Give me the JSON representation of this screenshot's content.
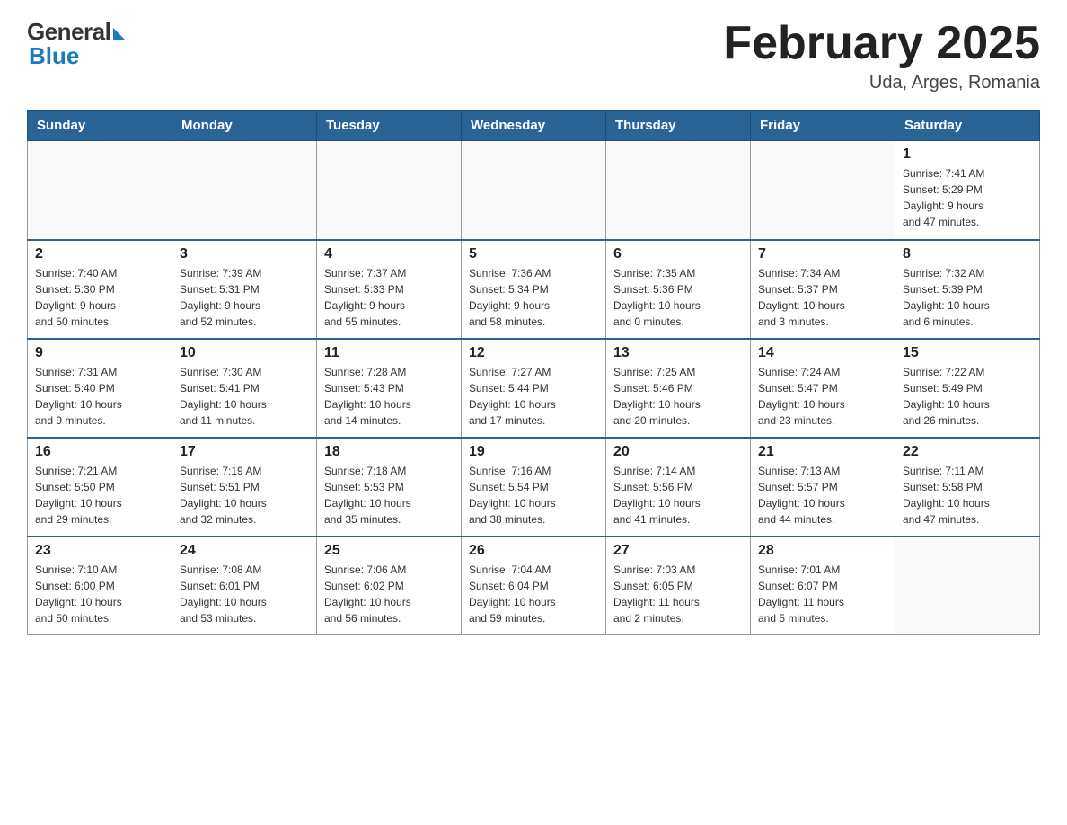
{
  "header": {
    "logo_general": "General",
    "logo_blue": "Blue",
    "month_title": "February 2025",
    "location": "Uda, Arges, Romania"
  },
  "weekdays": [
    "Sunday",
    "Monday",
    "Tuesday",
    "Wednesday",
    "Thursday",
    "Friday",
    "Saturday"
  ],
  "weeks": [
    [
      {
        "day": "",
        "info": ""
      },
      {
        "day": "",
        "info": ""
      },
      {
        "day": "",
        "info": ""
      },
      {
        "day": "",
        "info": ""
      },
      {
        "day": "",
        "info": ""
      },
      {
        "day": "",
        "info": ""
      },
      {
        "day": "1",
        "info": "Sunrise: 7:41 AM\nSunset: 5:29 PM\nDaylight: 9 hours\nand 47 minutes."
      }
    ],
    [
      {
        "day": "2",
        "info": "Sunrise: 7:40 AM\nSunset: 5:30 PM\nDaylight: 9 hours\nand 50 minutes."
      },
      {
        "day": "3",
        "info": "Sunrise: 7:39 AM\nSunset: 5:31 PM\nDaylight: 9 hours\nand 52 minutes."
      },
      {
        "day": "4",
        "info": "Sunrise: 7:37 AM\nSunset: 5:33 PM\nDaylight: 9 hours\nand 55 minutes."
      },
      {
        "day": "5",
        "info": "Sunrise: 7:36 AM\nSunset: 5:34 PM\nDaylight: 9 hours\nand 58 minutes."
      },
      {
        "day": "6",
        "info": "Sunrise: 7:35 AM\nSunset: 5:36 PM\nDaylight: 10 hours\nand 0 minutes."
      },
      {
        "day": "7",
        "info": "Sunrise: 7:34 AM\nSunset: 5:37 PM\nDaylight: 10 hours\nand 3 minutes."
      },
      {
        "day": "8",
        "info": "Sunrise: 7:32 AM\nSunset: 5:39 PM\nDaylight: 10 hours\nand 6 minutes."
      }
    ],
    [
      {
        "day": "9",
        "info": "Sunrise: 7:31 AM\nSunset: 5:40 PM\nDaylight: 10 hours\nand 9 minutes."
      },
      {
        "day": "10",
        "info": "Sunrise: 7:30 AM\nSunset: 5:41 PM\nDaylight: 10 hours\nand 11 minutes."
      },
      {
        "day": "11",
        "info": "Sunrise: 7:28 AM\nSunset: 5:43 PM\nDaylight: 10 hours\nand 14 minutes."
      },
      {
        "day": "12",
        "info": "Sunrise: 7:27 AM\nSunset: 5:44 PM\nDaylight: 10 hours\nand 17 minutes."
      },
      {
        "day": "13",
        "info": "Sunrise: 7:25 AM\nSunset: 5:46 PM\nDaylight: 10 hours\nand 20 minutes."
      },
      {
        "day": "14",
        "info": "Sunrise: 7:24 AM\nSunset: 5:47 PM\nDaylight: 10 hours\nand 23 minutes."
      },
      {
        "day": "15",
        "info": "Sunrise: 7:22 AM\nSunset: 5:49 PM\nDaylight: 10 hours\nand 26 minutes."
      }
    ],
    [
      {
        "day": "16",
        "info": "Sunrise: 7:21 AM\nSunset: 5:50 PM\nDaylight: 10 hours\nand 29 minutes."
      },
      {
        "day": "17",
        "info": "Sunrise: 7:19 AM\nSunset: 5:51 PM\nDaylight: 10 hours\nand 32 minutes."
      },
      {
        "day": "18",
        "info": "Sunrise: 7:18 AM\nSunset: 5:53 PM\nDaylight: 10 hours\nand 35 minutes."
      },
      {
        "day": "19",
        "info": "Sunrise: 7:16 AM\nSunset: 5:54 PM\nDaylight: 10 hours\nand 38 minutes."
      },
      {
        "day": "20",
        "info": "Sunrise: 7:14 AM\nSunset: 5:56 PM\nDaylight: 10 hours\nand 41 minutes."
      },
      {
        "day": "21",
        "info": "Sunrise: 7:13 AM\nSunset: 5:57 PM\nDaylight: 10 hours\nand 44 minutes."
      },
      {
        "day": "22",
        "info": "Sunrise: 7:11 AM\nSunset: 5:58 PM\nDaylight: 10 hours\nand 47 minutes."
      }
    ],
    [
      {
        "day": "23",
        "info": "Sunrise: 7:10 AM\nSunset: 6:00 PM\nDaylight: 10 hours\nand 50 minutes."
      },
      {
        "day": "24",
        "info": "Sunrise: 7:08 AM\nSunset: 6:01 PM\nDaylight: 10 hours\nand 53 minutes."
      },
      {
        "day": "25",
        "info": "Sunrise: 7:06 AM\nSunset: 6:02 PM\nDaylight: 10 hours\nand 56 minutes."
      },
      {
        "day": "26",
        "info": "Sunrise: 7:04 AM\nSunset: 6:04 PM\nDaylight: 10 hours\nand 59 minutes."
      },
      {
        "day": "27",
        "info": "Sunrise: 7:03 AM\nSunset: 6:05 PM\nDaylight: 11 hours\nand 2 minutes."
      },
      {
        "day": "28",
        "info": "Sunrise: 7:01 AM\nSunset: 6:07 PM\nDaylight: 11 hours\nand 5 minutes."
      },
      {
        "day": "",
        "info": ""
      }
    ]
  ]
}
